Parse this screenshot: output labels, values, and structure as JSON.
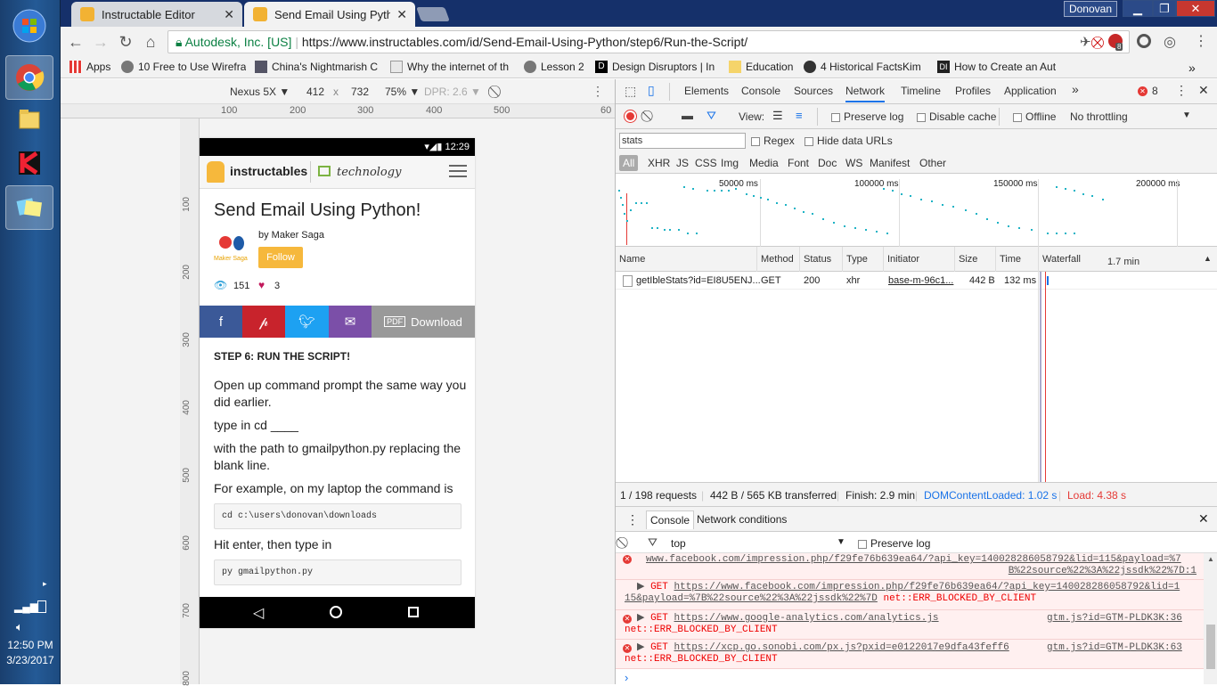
{
  "browser": {
    "tabs": [
      {
        "title": "Instructable Editor"
      },
      {
        "title": "Send Email Using Python"
      }
    ],
    "user": "Donovan",
    "url_owner": "Autodesk, Inc. [US]",
    "url": "https://www.instructables.com/id/Send-Email-Using-Python/step6/Run-the-Script/",
    "bookmarks": [
      "Apps",
      "10 Free to Use Wirefra",
      "China's Nightmarish C",
      "Why the internet of th",
      "Lesson 2",
      "Design Disruptors | In",
      "Education",
      "4 Historical FactsKim",
      "How to Create an Aut"
    ],
    "badge": "8"
  },
  "device_toolbar": {
    "device": "Nexus 5X",
    "width": "412",
    "times": "x",
    "height": "732",
    "zoom": "75%",
    "dpr": "DPR: 2.6"
  },
  "ruler": {
    "h": [
      "100",
      "200",
      "300",
      "400",
      "500",
      "60"
    ],
    "v": [
      "100",
      "200",
      "300",
      "400",
      "500",
      "600",
      "700",
      "800"
    ]
  },
  "phone": {
    "time": "12:29",
    "logo": "instructables",
    "category": "technology",
    "title": "Send Email Using Python!",
    "by": "by Maker Saga",
    "avatar_label": "Maker Saga",
    "follow": "Follow",
    "views": "151",
    "likes": "3",
    "download": "Download",
    "step_title": "STEP 6: RUN THE SCRIPT!",
    "p1": "Open up command prompt the same way you did earlier.",
    "p2": "type in cd ____",
    "p3": "with the path to gmailpython.py replacing the blank line.",
    "p4": "For example, on my laptop the command is",
    "code1": "cd c:\\users\\donovan\\downloads",
    "p5": "Hit enter, then type in",
    "code2": "py gmailpython.py"
  },
  "devtools": {
    "tabs": [
      "Elements",
      "Console",
      "Sources",
      "Network",
      "Timeline",
      "Profiles",
      "Application"
    ],
    "error_count": "8",
    "view_label": "View:",
    "preserve_log": "Preserve log",
    "disable_cache": "Disable cache",
    "offline": "Offline",
    "throttling": "No throttling",
    "filter_value": "stats",
    "regex": "Regex",
    "hide_data_urls": "Hide data URLs",
    "types": [
      "All",
      "XHR",
      "JS",
      "CSS",
      "Img",
      "Media",
      "Font",
      "Doc",
      "WS",
      "Manifest",
      "Other"
    ],
    "timeline_ticks": [
      "50000 ms",
      "100000 ms",
      "150000 ms",
      "200000 ms"
    ],
    "columns": [
      "Name",
      "Method",
      "Status",
      "Type",
      "Initiator",
      "Size",
      "Time",
      "Waterfall"
    ],
    "waterfall_scale": "1.7 min",
    "row": {
      "name": "getIbleStats?id=EI8U5ENJ...",
      "method": "GET",
      "status": "200",
      "type": "xhr",
      "initiator": "base-m-96c1...",
      "size": "442 B",
      "time": "132 ms"
    },
    "summary": {
      "requests": "1 / 198 requests",
      "transferred": "442 B / 565 KB transferred",
      "finish": "Finish: 2.9 min",
      "dcl": "DOMContentLoaded: 1.02 s",
      "load": "Load: 4.38 s"
    },
    "drawer_tabs": [
      "Console",
      "Network conditions"
    ],
    "context": "top",
    "console_preserve": "Preserve log",
    "console": {
      "l1a": "www.facebook.com/impression.php/f29fe76b639ea64/?api_key=140028286058792&lid=115&payload=%7",
      "l1b": "B%22source%22%3A%22jssdk%22%7D:1",
      "l2_get": "GET",
      "l2_url": "https://www.facebook.com/impression.php/f29fe76b639ea64/?api_key=140028286058792&lid=1",
      "l2b": "15&payload=%7B%22source%22%3A%22jssdk%22%7D",
      "l2_err": "net::ERR_BLOCKED_BY_CLIENT",
      "l3_get": "GET",
      "l3_url": "https://www.google-analytics.com/analytics.js",
      "l3_src": "gtm.js?id=GTM-PLDK3K:36",
      "l3_err": "net::ERR_BLOCKED_BY_CLIENT",
      "l4_get": "GET",
      "l4_url": "https://xcp.go.sonobi.com/px.js?pxid=e0122017e9dfa43feff6",
      "l4_src": "gtm.js?id=GTM-PLDK3K:63",
      "l4_err": "net::ERR_BLOCKED_BY_CLIENT"
    }
  },
  "clock": {
    "time": "12:50 PM",
    "date": "3/23/2017"
  },
  "colors": {
    "accent": "#1a73e8",
    "error": "#e53935",
    "follow": "#f6b83c"
  }
}
